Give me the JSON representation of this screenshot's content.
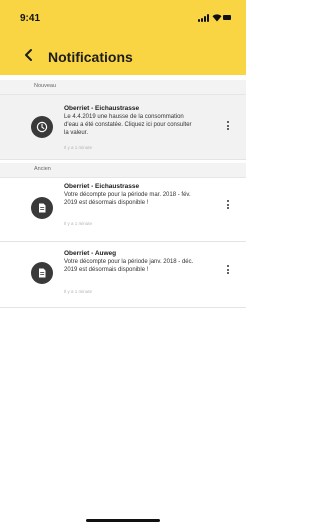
{
  "status_bar": {
    "time": "9:41"
  },
  "header": {
    "title": "Notifications"
  },
  "sections": {
    "new_label": "Nouveau",
    "old_label": "Ancien"
  },
  "notifications": [
    {
      "title": "Oberriet - Eichaustrasse",
      "body": "Le 4.4.2019 une hausse de la consommation d'eau a été constatée. Cliquez ici pour consulter la valeur.",
      "time": "Il y a 1 minute",
      "icon": "clock-icon"
    },
    {
      "title": "Oberriet - Eichaustrasse",
      "body": "Votre décompte pour la période mar. 2018 - fév. 2019 est désormais disponible !",
      "time": "Il y a 1 minute",
      "icon": "document-icon"
    },
    {
      "title": "Oberriet - Auweg",
      "body": "Votre décompte pour la période janv. 2018 - déc. 2019 est désormais disponible !",
      "time": "Il y a 1 minute",
      "icon": "document-icon"
    }
  ],
  "colors": {
    "header": "#f9d544",
    "icon_bg": "#3a3a3a",
    "unread_bg": "#f2f2f2"
  }
}
